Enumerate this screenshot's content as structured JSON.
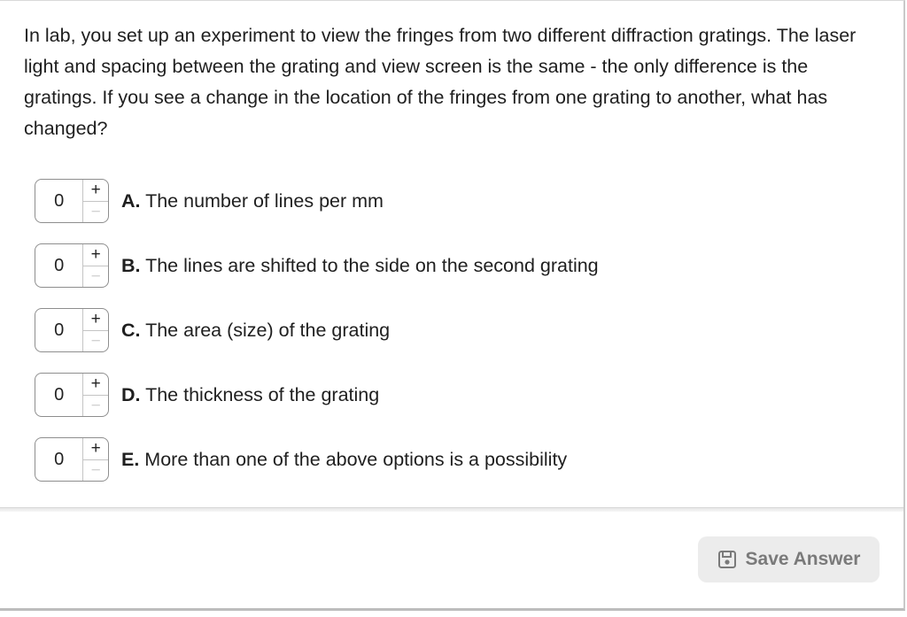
{
  "question": {
    "text": "In lab, you set up an experiment to view the fringes from two different diffraction gratings. The laser light and spacing between the grating and view screen is the same - the only difference is the gratings. If you see a change in the location of the fringes from one grating to another, what has changed?"
  },
  "options": [
    {
      "value": "0",
      "plus": "+",
      "minus": "−",
      "letter": "A.",
      "text": " The number of lines per mm"
    },
    {
      "value": "0",
      "plus": "+",
      "minus": "−",
      "letter": "B.",
      "text": " The lines are shifted to the side on the second grating"
    },
    {
      "value": "0",
      "plus": "+",
      "minus": "−",
      "letter": "C.",
      "text": " The area (size) of the grating"
    },
    {
      "value": "0",
      "plus": "+",
      "minus": "−",
      "letter": "D.",
      "text": " The thickness of the grating"
    },
    {
      "value": "0",
      "plus": "+",
      "minus": "−",
      "letter": "E.",
      "text": " More than one of the above options is a possibility"
    }
  ],
  "footer": {
    "save_label": "Save Answer",
    "save_icon": "floppy-disk-icon"
  },
  "colors": {
    "text": "#1f1f1f",
    "save_button_bg": "#ececec",
    "save_button_text": "#7a7a7a",
    "stepper_border": "#8e8e8e"
  }
}
